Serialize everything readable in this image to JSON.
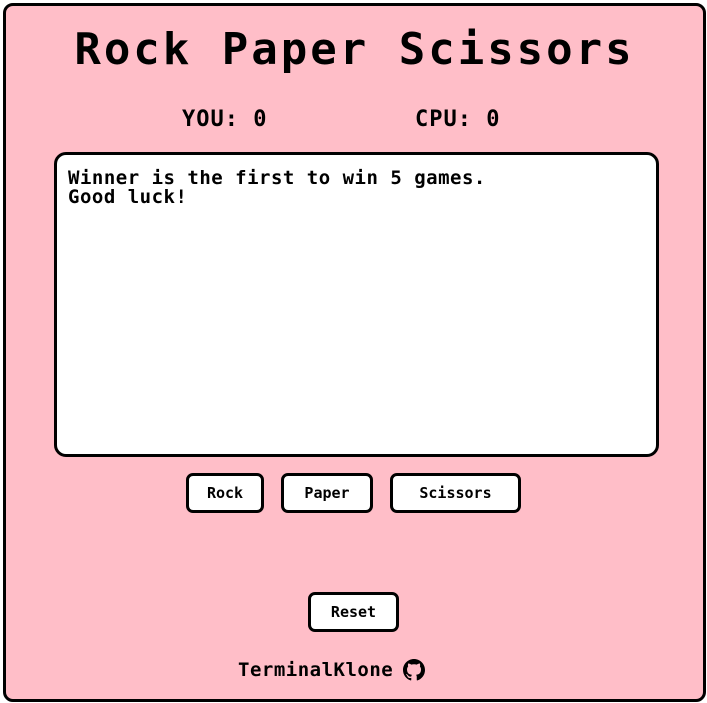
{
  "title": "Rock Paper Scissors",
  "score": {
    "you_label": "YOU: 0",
    "cpu_label": "CPU: 0"
  },
  "log": {
    "text": "Winner is the first to win 5 games.\nGood luck!"
  },
  "choices": {
    "rock_label": "Rock",
    "paper_label": "Paper",
    "scissors_label": "Scissors"
  },
  "reset_label": "Reset",
  "footer": {
    "author": "TerminalKlone",
    "icon": "github-icon"
  },
  "colors": {
    "background": "#ffbec8",
    "panel": "#ffffff",
    "border": "#000000"
  }
}
